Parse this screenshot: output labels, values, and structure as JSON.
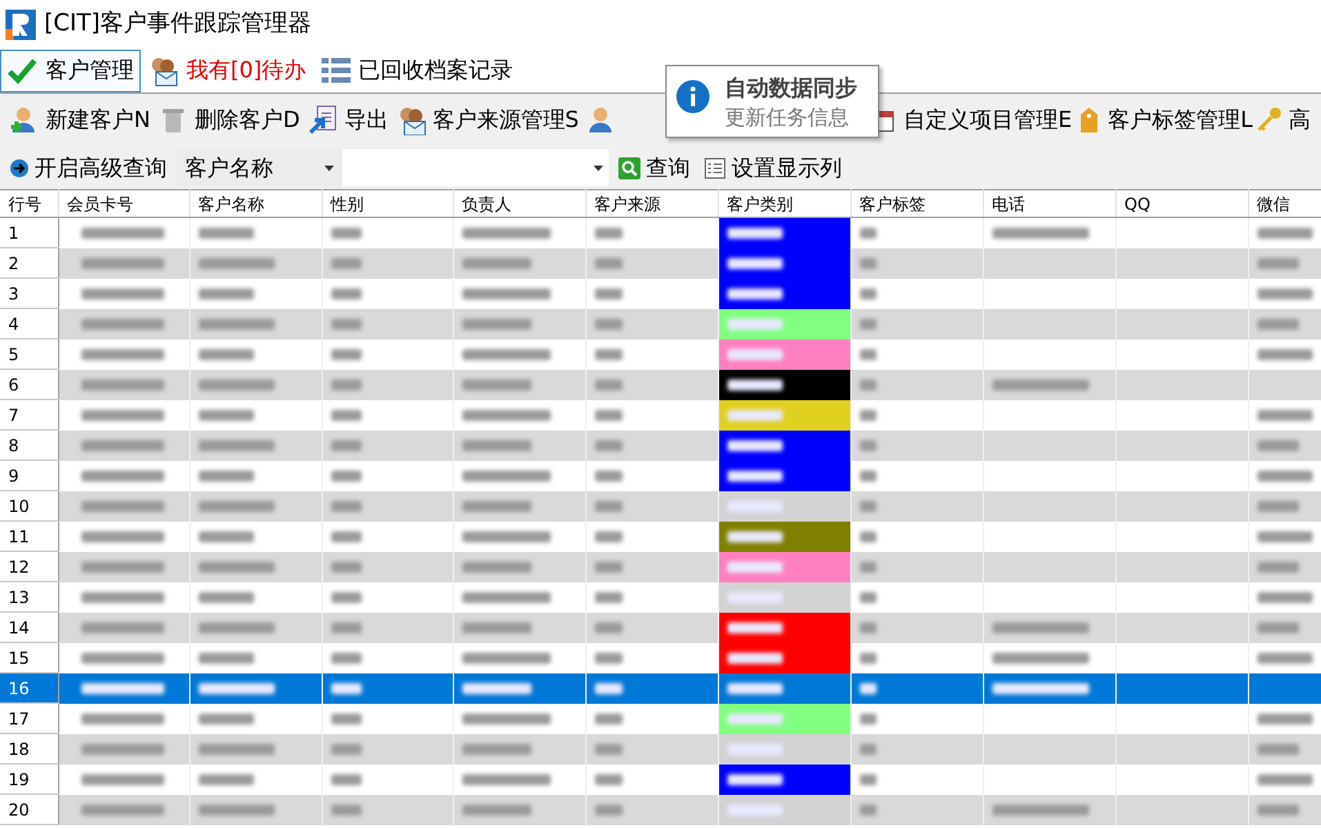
{
  "window": {
    "title": "[CIT]客户事件跟踪管理器"
  },
  "tabs": [
    {
      "label": "客户管理",
      "selected": true,
      "alert": false
    },
    {
      "label": "我有[0]待办",
      "selected": false,
      "alert": true
    },
    {
      "label": "已回收档案记录",
      "selected": false,
      "alert": false
    }
  ],
  "toolbar": [
    {
      "kind": "button",
      "label": "新建客户N"
    },
    {
      "kind": "button",
      "label": "删除客户D"
    },
    {
      "kind": "button",
      "label": "导出"
    },
    {
      "kind": "button",
      "label": "客户来源管理S"
    },
    {
      "kind": "covered"
    },
    {
      "kind": "button",
      "label": "自定义项目管理E"
    },
    {
      "kind": "button",
      "label": "客户标签管理L"
    },
    {
      "kind": "button",
      "label": "高"
    }
  ],
  "tooltip": {
    "title": "自动数据同步",
    "text": "更新任务信息"
  },
  "search": {
    "advanced_label": "开启高级查询",
    "field": "客户名称",
    "query_button": "查询",
    "columns_button": "设置显示列"
  },
  "table": {
    "columns": [
      "行号",
      "会员卡号",
      "客户名称",
      "性别",
      "负责人",
      "客户来源",
      "客户类别",
      "客户标签",
      "电话",
      "QQ",
      "微信"
    ],
    "rows": [
      {
        "number": "1",
        "selected": false,
        "color": "#0000ff",
        "has_phone": true,
        "has_wechat": true
      },
      {
        "number": "2",
        "selected": false,
        "color": "#0000ff",
        "has_phone": false,
        "has_wechat": true
      },
      {
        "number": "3",
        "selected": false,
        "color": "#0000ff",
        "has_phone": false,
        "has_wechat": true
      },
      {
        "number": "4",
        "selected": false,
        "color": "#80ff80",
        "has_phone": false,
        "has_wechat": true
      },
      {
        "number": "5",
        "selected": false,
        "color": "#ff80c0",
        "has_phone": false,
        "has_wechat": true
      },
      {
        "number": "6",
        "selected": false,
        "color": "#000000",
        "has_phone": true,
        "has_wechat": false
      },
      {
        "number": "7",
        "selected": false,
        "color": "#e0d020",
        "has_phone": false,
        "has_wechat": true
      },
      {
        "number": "8",
        "selected": false,
        "color": "#0000ff",
        "has_phone": false,
        "has_wechat": true
      },
      {
        "number": "9",
        "selected": false,
        "color": "#0000ff",
        "has_phone": false,
        "has_wechat": true
      },
      {
        "number": "10",
        "selected": false,
        "color": "#d3d3d3",
        "has_phone": false,
        "has_wechat": true
      },
      {
        "number": "11",
        "selected": false,
        "color": "#808000",
        "has_phone": false,
        "has_wechat": true
      },
      {
        "number": "12",
        "selected": false,
        "color": "#ff80c0",
        "has_phone": false,
        "has_wechat": true
      },
      {
        "number": "13",
        "selected": false,
        "color": "#d3d3d3",
        "has_phone": false,
        "has_wechat": true
      },
      {
        "number": "14",
        "selected": false,
        "color": "#ff0000",
        "has_phone": true,
        "has_wechat": true
      },
      {
        "number": "15",
        "selected": false,
        "color": "#ff0000",
        "has_phone": true,
        "has_wechat": true
      },
      {
        "number": "16",
        "selected": true,
        "color": "#0078d7",
        "has_phone": true,
        "has_wechat": false
      },
      {
        "number": "17",
        "selected": false,
        "color": "#80ff80",
        "has_phone": false,
        "has_wechat": true
      },
      {
        "number": "18",
        "selected": false,
        "color": "#d3d3d3",
        "has_phone": false,
        "has_wechat": true
      },
      {
        "number": "19",
        "selected": false,
        "color": "#0000ff",
        "has_phone": false,
        "has_wechat": true
      },
      {
        "number": "20",
        "selected": false,
        "color": "#d3d3d3",
        "has_phone": true,
        "has_wechat": true
      }
    ]
  }
}
